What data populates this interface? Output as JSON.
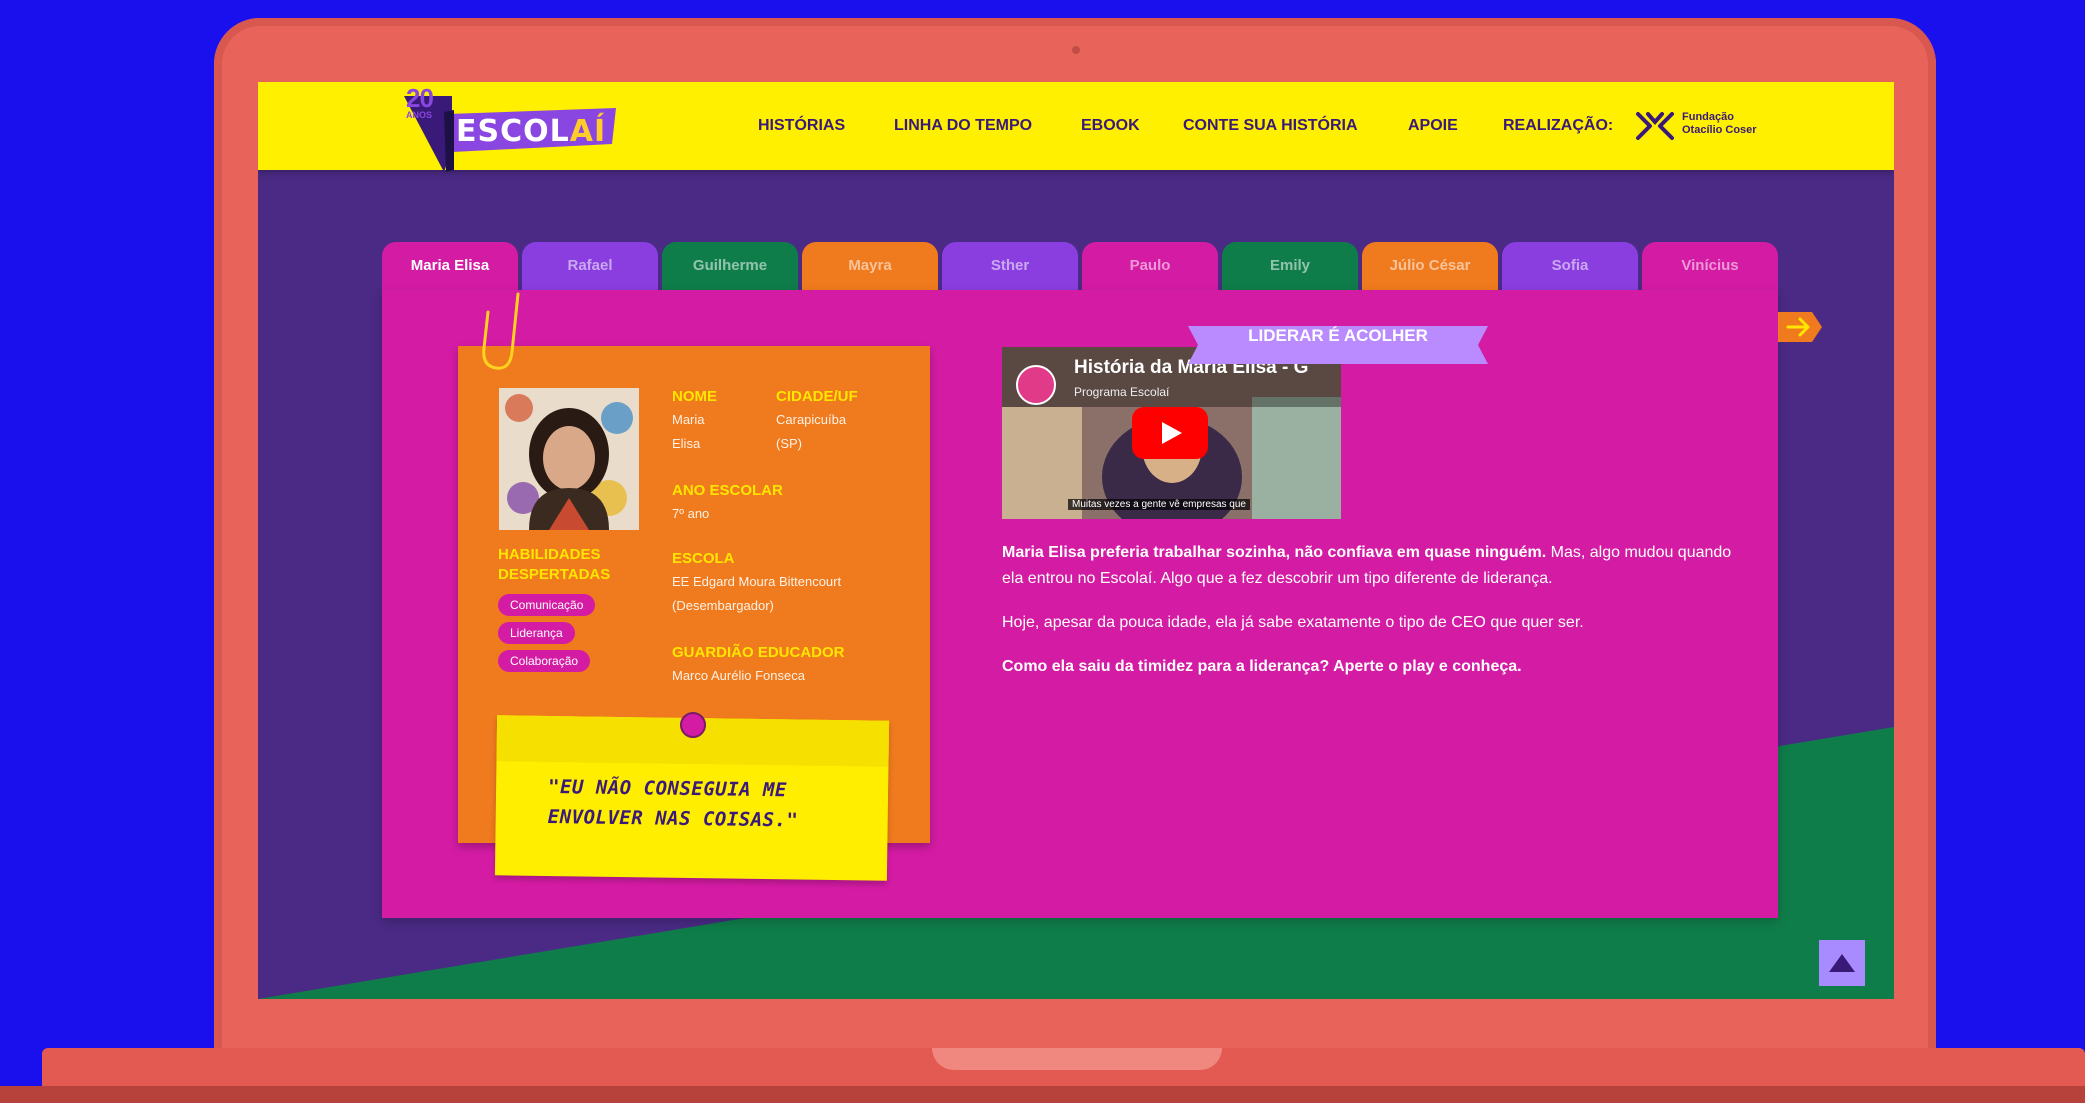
{
  "colors": {
    "background": "#1a10ee",
    "laptop": "#e8635a",
    "header": "#fff000",
    "panel": "#d41ba4",
    "card": "#f07a1e",
    "screen": "#4a2a85",
    "green": "#0f7d4a"
  },
  "logo": {
    "number": "20",
    "anos": "ANOS",
    "name_main": "ESCOL",
    "name_accent": "AÍ"
  },
  "nav": {
    "items": [
      "HISTÓRIAS",
      "LINHA DO TEMPO",
      "EBOOK",
      "CONTE SUA HISTÓRIA",
      "APOIE"
    ],
    "realizacao": "REALIZAÇÃO:",
    "sponsor_line1": "Fundação",
    "sponsor_line2": "Otacílio Coser"
  },
  "tabs": [
    {
      "label": "Maria Elisa",
      "color": "#d41ba4",
      "active": true
    },
    {
      "label": "Rafael",
      "color": "#8a3ee0"
    },
    {
      "label": "Guilherme",
      "color": "#0f7d4a"
    },
    {
      "label": "Mayra",
      "color": "#f07a1e"
    },
    {
      "label": "Sther",
      "color": "#8a3ee0"
    },
    {
      "label": "Paulo",
      "color": "#d41ba4"
    },
    {
      "label": "Emily",
      "color": "#0f7d4a"
    },
    {
      "label": "Júlio César",
      "color": "#f07a1e"
    },
    {
      "label": "Sofia",
      "color": "#8a3ee0"
    },
    {
      "label": "Vinícius",
      "color": "#d41ba4"
    }
  ],
  "profile": {
    "nome_label": "NOME",
    "nome_1": "Maria",
    "nome_2": "Elisa",
    "cidade_label": "CIDADE/UF",
    "cidade_1": "Carapicuíba",
    "cidade_2": "(SP)",
    "ano_label": "ANO ESCOLAR",
    "ano": "7º ano",
    "escola_label": "ESCOLA",
    "escola_1": "EE Edgard Moura Bittencourt",
    "escola_2": "(Desembargador)",
    "guardiao_label": "GUARDIÃO EDUCADOR",
    "guardiao": "Marco Aurélio Fonseca",
    "habilidades_label_1": "HABILIDADES",
    "habilidades_label_2": "DESPERTADAS",
    "skills": [
      "Comunicação",
      "Liderança",
      "Colaboração"
    ]
  },
  "quote": {
    "line1": "\"EU NÃO CONSEGUIA ME",
    "line2": "ENVOLVER NAS COISAS.\""
  },
  "video": {
    "title": "História da Maria Elisa - G",
    "channel": "Programa Escolaí",
    "caption": "Muitas vezes a gente vê empresas que"
  },
  "banner": "LIDERAR É ACOLHER",
  "story": {
    "p1_bold": "Maria Elisa preferia trabalhar sozinha, não confiava em quase ninguém.",
    "p1_rest": "Mas, algo mudou quando ela entrou no Escolaí. Algo que a fez descobrir um tipo diferente de liderança.",
    "p2": "Hoje, apesar da pouca idade, ela já sabe exatamente o tipo de CEO que quer ser.",
    "p3": "Como ela saiu da timidez para a liderança? Aperte o play e conheça."
  }
}
